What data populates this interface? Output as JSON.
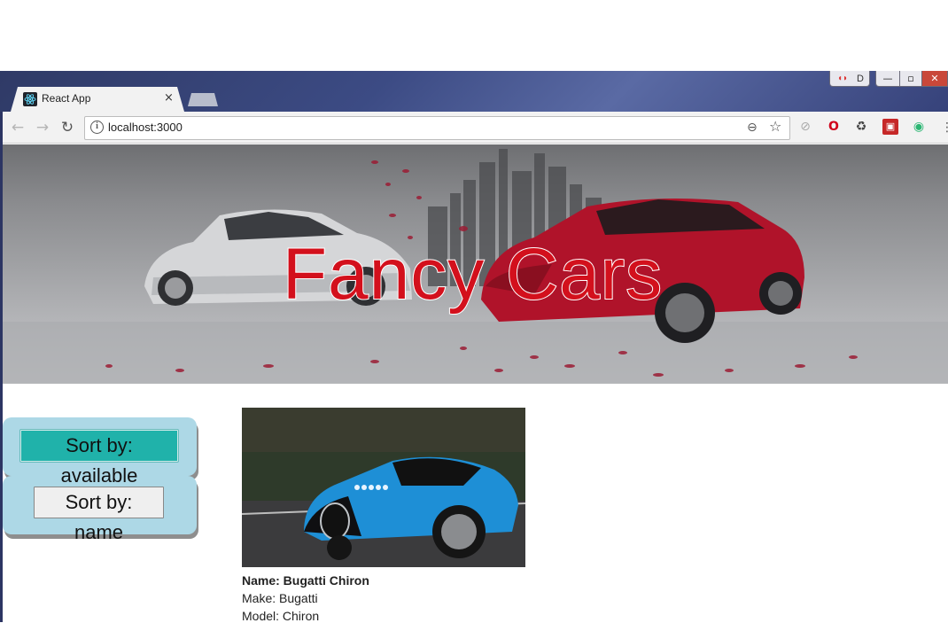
{
  "browser": {
    "tab_title": "React App",
    "tab_close": "×",
    "url": "localhost:3000",
    "profile_label": "D",
    "window_buttons": {
      "minimize": "—",
      "maximize": "▫",
      "close": "✕"
    }
  },
  "toolbar_icons": [
    "back-arrow-icon",
    "forward-arrow-icon",
    "reload-icon",
    "info-icon",
    "zoom-icon",
    "star-icon",
    "menu-icon"
  ],
  "banner": {
    "title": "Fancy Cars"
  },
  "sort": {
    "available_label": "Sort by: available",
    "name_label": "Sort by: name"
  },
  "car": {
    "name_line": "Name: Bugatti Chiron",
    "make_line": "Make: Bugatti",
    "model_line": "Model: Chiron"
  },
  "colors": {
    "title_red": "#d3101c",
    "sort_panel_bg": "#add8e6",
    "active_sort_bg": "#20b2aa",
    "car_body_blue": "#1e8fd6"
  }
}
